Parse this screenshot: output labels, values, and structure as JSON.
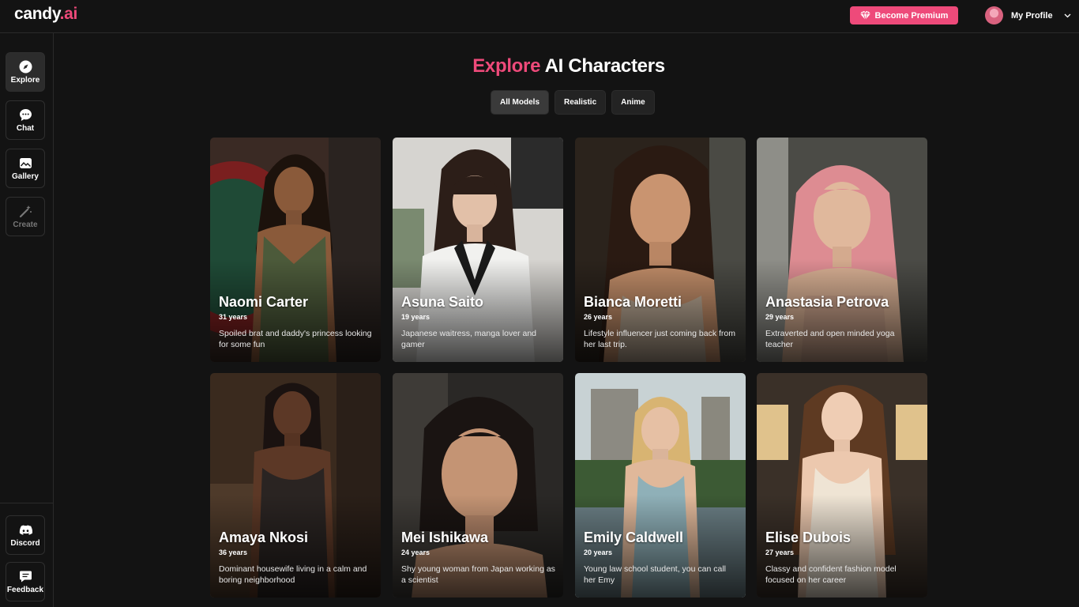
{
  "header": {
    "logo_main": "candy",
    "logo_ai": ".ai",
    "premium_label": "Become Premium",
    "profile_label": "My Profile"
  },
  "sidebar": {
    "top_items": [
      {
        "label": "Explore",
        "icon": "compass-icon",
        "active": true
      },
      {
        "label": "Chat",
        "icon": "chat-bubble-icon"
      },
      {
        "label": "Gallery",
        "icon": "gallery-icon"
      },
      {
        "label": "Create",
        "icon": "magic-wand-icon",
        "disabled": true
      }
    ],
    "bottom_items": [
      {
        "label": "Discord",
        "icon": "discord-icon"
      },
      {
        "label": "Feedback",
        "icon": "feedback-icon"
      }
    ]
  },
  "main": {
    "title_accent": "Explore",
    "title_rest": " AI Characters",
    "filters": [
      "All Models",
      "Realistic",
      "Anime"
    ],
    "active_filter": "All Models",
    "characters": [
      {
        "name": "Naomi Carter",
        "age": "31 years",
        "description": "Spoiled brat and daddy's princess looking for some fun"
      },
      {
        "name": "Asuna Saito",
        "age": "19 years",
        "description": "Japanese waitress, manga lover and gamer"
      },
      {
        "name": "Bianca Moretti",
        "age": "26 years",
        "description": "Lifestyle influencer just coming back from her last trip."
      },
      {
        "name": "Anastasia Petrova",
        "age": "29 years",
        "description": "Extraverted and open minded yoga teacher"
      },
      {
        "name": "Amaya Nkosi",
        "age": "36 years",
        "description": "Dominant housewife living in a calm and boring neighborhood"
      },
      {
        "name": "Mei Ishikawa",
        "age": "24 years",
        "description": "Shy young woman from Japan working as a scientist"
      },
      {
        "name": "Emily Caldwell",
        "age": "20 years",
        "description": "Young law school student, you can call her Emy"
      },
      {
        "name": "Elise Dubois",
        "age": "27 years",
        "description": "Classy and confident fashion model focused on her career"
      }
    ]
  },
  "colors": {
    "accent": "#ee4a7a",
    "background": "#131313"
  }
}
